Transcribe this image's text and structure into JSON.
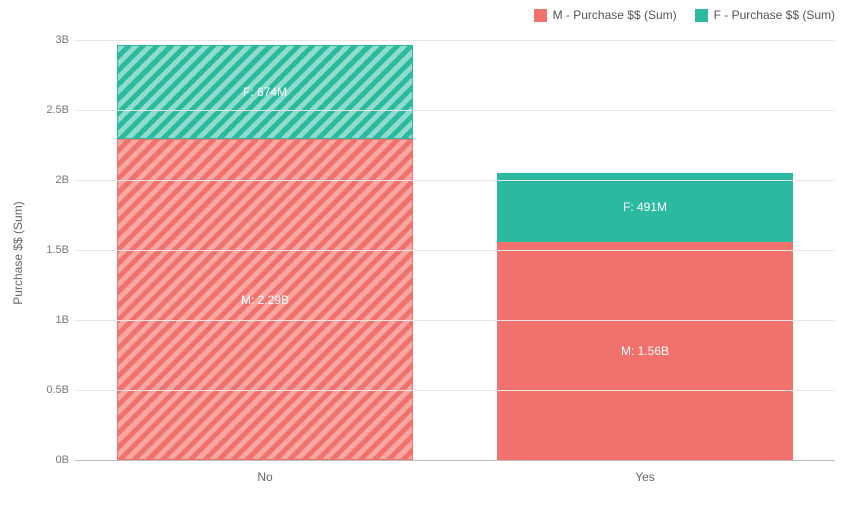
{
  "chart_data": {
    "type": "bar",
    "stacked": true,
    "categories": [
      "No",
      "Yes"
    ],
    "series": [
      {
        "name": "M - Purchase $$ (Sum)",
        "values": [
          2290000000,
          1560000000
        ],
        "labels": [
          "M: 2.29B",
          "M: 1.56B"
        ],
        "color": "#f1716c",
        "patterned": [
          true,
          false
        ]
      },
      {
        "name": "F - Purchase $$ (Sum)",
        "values": [
          674000000,
          491000000
        ],
        "labels": [
          "F: 674M",
          "F: 491M"
        ],
        "color": "#2bbaa0",
        "patterned": [
          true,
          false
        ]
      }
    ],
    "ylabel": "Purchase $$ (Sum)",
    "ylim": [
      0,
      3000000000
    ],
    "yticks": [
      0,
      500000000,
      1000000000,
      1500000000,
      2000000000,
      2500000000,
      3000000000
    ],
    "ytick_labels": [
      "0B",
      "0.5B",
      "1B",
      "1.5B",
      "2B",
      "2.5B",
      "3B"
    ]
  },
  "legend": {
    "m": "M - Purchase $$ (Sum)",
    "f": "F - Purchase $$ (Sum)"
  }
}
